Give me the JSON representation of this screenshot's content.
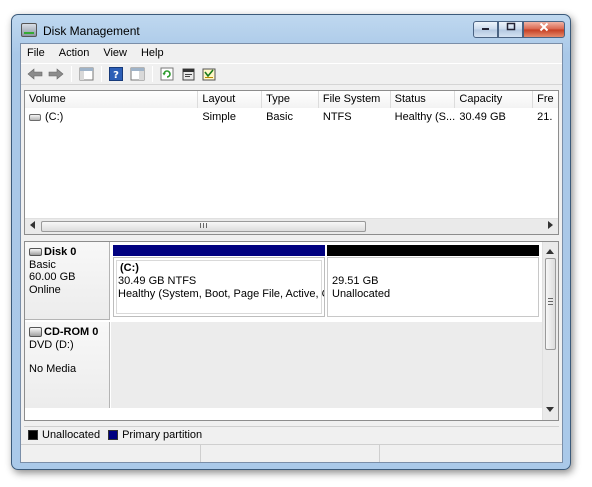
{
  "window": {
    "title": "Disk Management"
  },
  "menu": [
    "File",
    "Action",
    "View",
    "Help"
  ],
  "toolbar": {
    "icons": [
      "back-icon",
      "forward-icon",
      "console-tree-icon",
      "help-icon",
      "show-hide-icon",
      "refresh-icon",
      "properties-icon",
      "rescan-icon"
    ]
  },
  "volume_list": {
    "columns": [
      "Volume",
      "Layout",
      "Type",
      "File System",
      "Status",
      "Capacity",
      "Fre"
    ],
    "rows": [
      {
        "volume": "(C:)",
        "layout": "Simple",
        "type": "Basic",
        "file_system": "NTFS",
        "status": "Healthy (S...",
        "capacity": "30.49 GB",
        "free": "21."
      }
    ]
  },
  "disks": [
    {
      "name": "Disk 0",
      "type": "Basic",
      "size": "60.00 GB",
      "state": "Online",
      "partitions": [
        {
          "label": "(C:)",
          "size": "30.49 GB NTFS",
          "status": "Healthy (System, Boot, Page File, Active, Cras",
          "color": "#000080"
        },
        {
          "label": "",
          "size": "29.51 GB",
          "status": "Unallocated",
          "color": "#000000"
        }
      ]
    },
    {
      "name": "CD-ROM 0",
      "type": "DVD (D:)",
      "size": "",
      "state": "No Media"
    }
  ],
  "legend": [
    {
      "label": "Unallocated",
      "color": "#000000"
    },
    {
      "label": "Primary partition",
      "color": "#000080"
    }
  ]
}
